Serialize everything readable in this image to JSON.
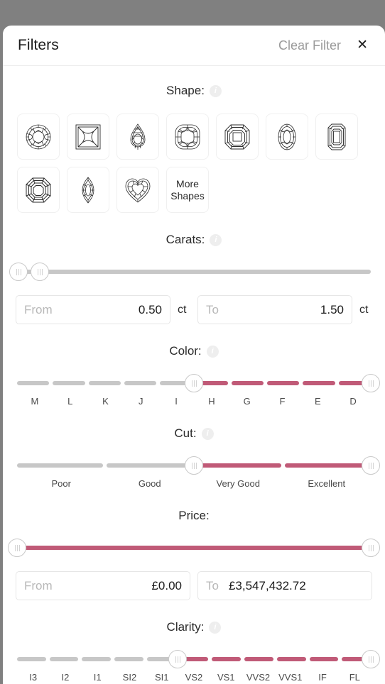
{
  "header": {
    "title": "Filters",
    "clear_label": "Clear Filter",
    "close_label": "✕"
  },
  "colors": {
    "accent": "#c05a77",
    "track": "#c7c7c7",
    "backdrop": "#808080",
    "panel": "#ffffff",
    "text": "#1b1b1b",
    "muted": "#9a9a9a"
  },
  "sections": {
    "shape": {
      "label": "Shape:",
      "info": "i",
      "tiles": [
        {
          "name": "round",
          "label": "Round"
        },
        {
          "name": "princess",
          "label": "Princess"
        },
        {
          "name": "pear",
          "label": "Pear"
        },
        {
          "name": "cushion",
          "label": "Cushion"
        },
        {
          "name": "asscher",
          "label": "Asscher"
        },
        {
          "name": "oval",
          "label": "Oval"
        },
        {
          "name": "emerald",
          "label": "Emerald"
        },
        {
          "name": "octagon",
          "label": "Octagon"
        },
        {
          "name": "marquise",
          "label": "Marquise"
        },
        {
          "name": "heart",
          "label": "Heart"
        }
      ],
      "more_label": "More\nShapes",
      "more_line1": "More",
      "more_line2": "Shapes"
    },
    "carats": {
      "label": "Carats:",
      "info": "i",
      "from_placeholder": "From",
      "from_value": "0.50",
      "to_placeholder": "To",
      "to_value": "1.50",
      "unit": "ct",
      "handle_low_pct": 0.5,
      "handle_high_pct": 6.5,
      "fill": "none"
    },
    "color": {
      "label": "Color:",
      "info": "i",
      "ticks": [
        "M",
        "L",
        "K",
        "J",
        "I",
        "H",
        "G",
        "F",
        "E",
        "D"
      ],
      "handle_low_pct": 50,
      "handle_high_pct": 100,
      "selected_from": "H",
      "selected_to": "D"
    },
    "cut": {
      "label": "Cut:",
      "info": "i",
      "ticks": [
        "Poor",
        "Good",
        "Very Good",
        "Excellent"
      ],
      "handle_low_pct": 50,
      "handle_high_pct": 100,
      "selected_from": "Very Good",
      "selected_to": "Excellent"
    },
    "price": {
      "label": "Price:",
      "info": "",
      "from_placeholder": "From",
      "from_value": "£0.00",
      "to_placeholder": "To",
      "to_value": "£3,547,432.72",
      "handle_low_pct": 0,
      "handle_high_pct": 100
    },
    "clarity": {
      "label": "Clarity:",
      "info": "i",
      "ticks": [
        "I3",
        "I2",
        "I1",
        "SI2",
        "SI1",
        "VS2",
        "VS1",
        "VVS2",
        "VVS1",
        "IF",
        "FL"
      ],
      "handle_low_pct": 45.45,
      "handle_high_pct": 100,
      "selected_from": "VS2",
      "selected_to": "FL"
    }
  }
}
